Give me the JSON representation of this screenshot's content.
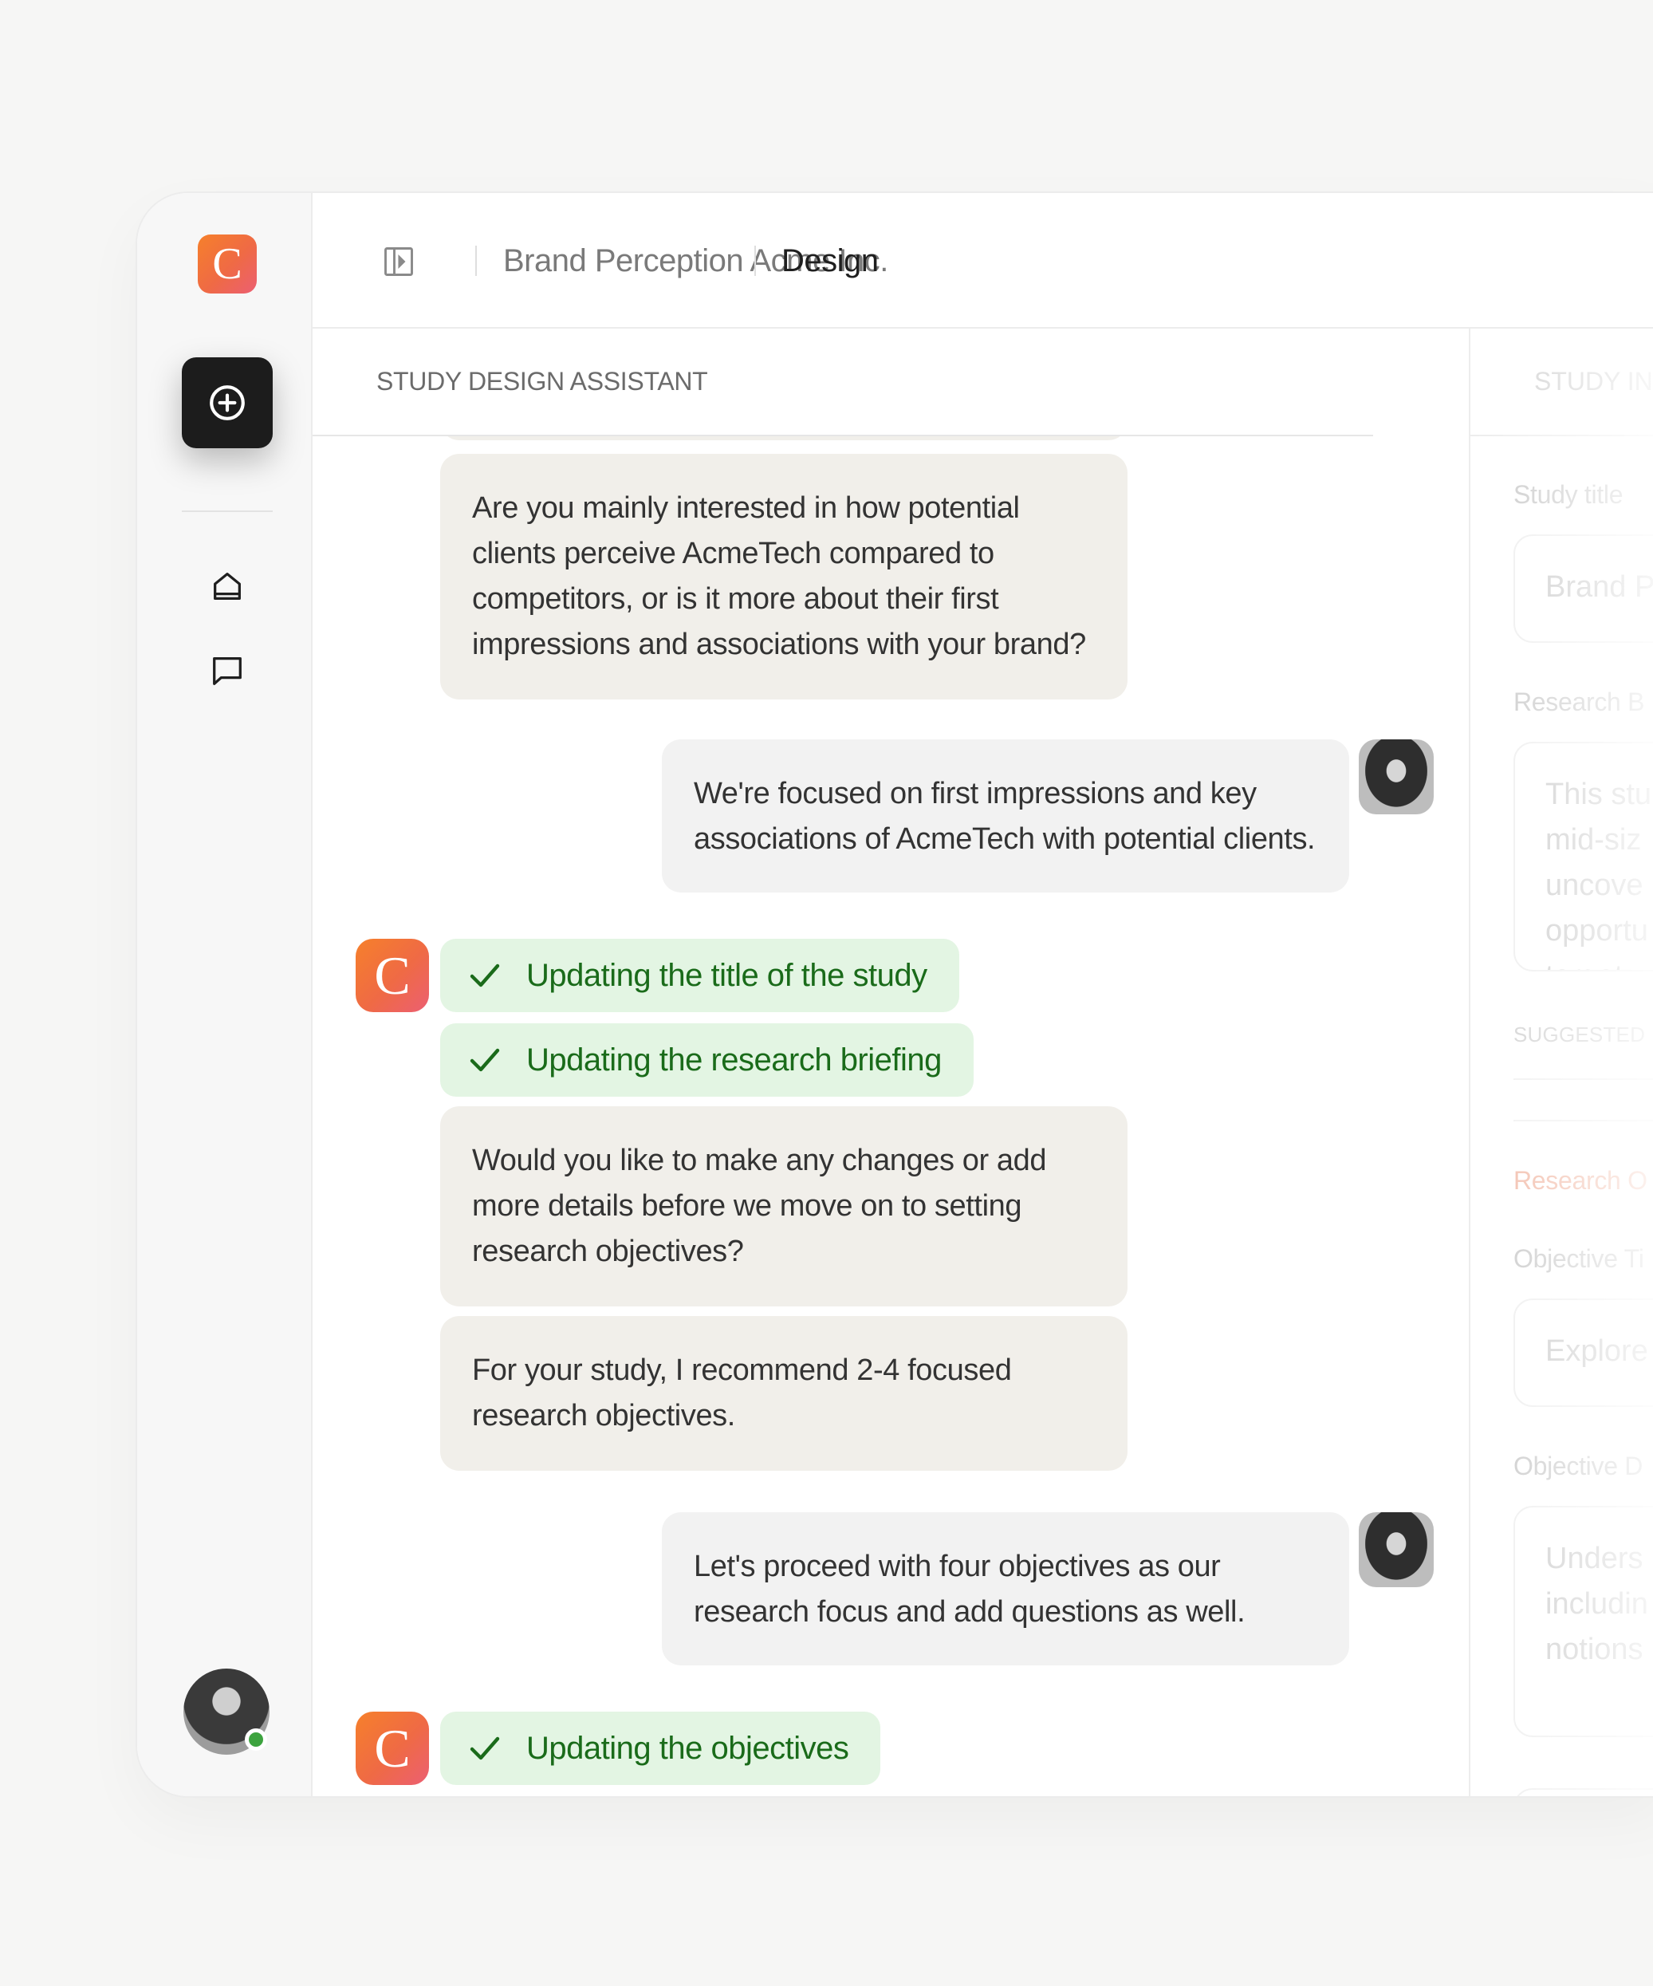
{
  "app": {
    "logo_letter": "C",
    "accent_gradient": [
      "#f6802b",
      "#ec5f72"
    ]
  },
  "sidebar": {
    "items": [
      {
        "name": "new-button",
        "icon": "plus-circle-icon"
      },
      {
        "name": "home",
        "icon": "home-icon"
      },
      {
        "name": "chats",
        "icon": "chat-icon"
      }
    ],
    "online_color": "#3da33f"
  },
  "header": {
    "breadcrumb": [
      "Brand Perception Acme Inc.",
      "Design"
    ]
  },
  "chat": {
    "title": "STUDY DESIGN ASSISTANT",
    "messages": [
      {
        "role": "assistant",
        "text": "Are you mainly interested in how potential clients perceive AcmeTech compared to competitors, or is it more about their first impressions and associations with your brand?"
      },
      {
        "role": "user",
        "text": "We're focused on first impressions and key associations of AcmeTech with potential clients."
      },
      {
        "role": "status",
        "text": "Updating the title of the study"
      },
      {
        "role": "status",
        "text": "Updating the research briefing"
      },
      {
        "role": "assistant",
        "text": "Would you like to make any changes or add more details before we move on to setting research objectives?"
      },
      {
        "role": "assistant",
        "text": "For your study, I recommend 2-4 focused research objectives."
      },
      {
        "role": "user",
        "text": "Let's proceed with four objectives as our research focus and add questions as well."
      },
      {
        "role": "status",
        "text": "Updating the objectives"
      }
    ]
  },
  "right_panel": {
    "title": "STUDY IN",
    "study_title_label": "Study title",
    "study_title_value": "Brand P",
    "briefing_label": "Research B",
    "briefing_lines": [
      "This stu",
      "mid-siz",
      "uncove",
      "opportu",
      "target"
    ],
    "suggested_label": "SUGGESTED",
    "objectives_label": "Research O",
    "objective_title_label": "Objective Ti",
    "objective_title_value": "Explore",
    "objective_desc_label": "Objective D",
    "objective_desc_lines": [
      "Unders",
      "includin",
      "notions"
    ]
  }
}
